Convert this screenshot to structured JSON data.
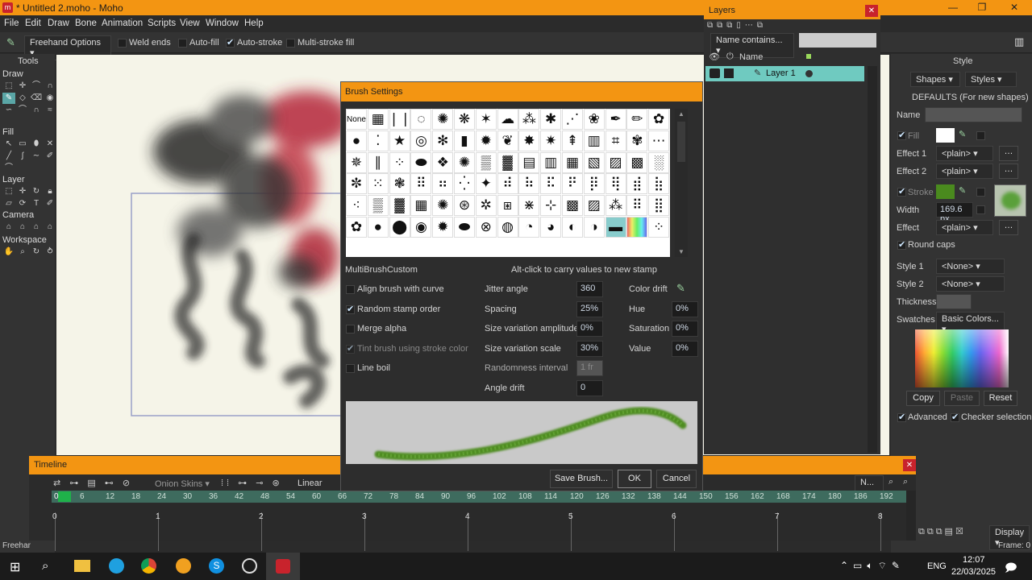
{
  "app": {
    "title": "* Untitled 2.moho - Moho",
    "logo": "moho-logo-icon"
  },
  "menu": [
    "File",
    "Edit",
    "Draw",
    "Bone",
    "Animation",
    "Scripts",
    "View",
    "Window",
    "Help"
  ],
  "options": {
    "freehand": "Freehand Options",
    "weld": "Weld ends",
    "autofill": "Auto-fill",
    "autostroke": "Auto-stroke",
    "multistroke": "Multi-stroke fill"
  },
  "tools": {
    "title": "Tools",
    "draw": "Draw",
    "fill": "Fill",
    "layer": "Layer",
    "camera": "Camera",
    "workspace": "Workspace",
    "status": "Freehar"
  },
  "layers": {
    "title": "Layers",
    "filter": "Name contains...",
    "col_name": "Name",
    "layer1": "Layer 1"
  },
  "brush": {
    "title": "Brush Settings",
    "none_label": "None",
    "name": "MultiBrushCustom",
    "hint": "Alt-click to carry values to new stamp",
    "checks": [
      {
        "label": "Align brush with curve",
        "on": false
      },
      {
        "label": "Random stamp order",
        "on": true
      },
      {
        "label": "Merge alpha",
        "on": false
      },
      {
        "label": "Tint brush using stroke color",
        "on": true
      },
      {
        "label": "Line boil",
        "on": false
      }
    ],
    "params": [
      {
        "label": "Jitter angle",
        "value": "360"
      },
      {
        "label": "Spacing",
        "value": "25%"
      },
      {
        "label": "Size variation amplitude",
        "value": "0%"
      },
      {
        "label": "Size variation scale",
        "value": "30%"
      },
      {
        "label": "Randomness interval",
        "value": "1 fr"
      },
      {
        "label": "Angle drift",
        "value": "0"
      }
    ],
    "color": [
      {
        "label": "Color drift",
        "value": ""
      },
      {
        "label": "Hue",
        "value": "0%"
      },
      {
        "label": "Saturation",
        "value": "0%"
      },
      {
        "label": "Value",
        "value": "0%"
      }
    ],
    "save": "Save Brush...",
    "ok": "OK",
    "cancel": "Cancel"
  },
  "style": {
    "title": "Style",
    "shapes": "Shapes",
    "styles": "Styles",
    "defaults": "DEFAULTS (For new shapes)",
    "name": "Name",
    "fill": "Fill",
    "effect1": "Effect 1",
    "effect2": "Effect 2",
    "plain": "<plain>",
    "stroke": "Stroke",
    "width": "Width",
    "width_val": "169.6 px",
    "effect": "Effect",
    "roundcaps": "Round caps",
    "style1": "Style 1",
    "style2": "Style 2",
    "none": "<None>",
    "thickness": "Thickness",
    "swatches": "Swatches",
    "swatch_val": "Basic Colors...",
    "copy": "Copy",
    "paste": "Paste",
    "reset": "Reset",
    "advanced": "Advanced",
    "checker": "Checker selection",
    "display": "Display",
    "frame": "Frame: 0",
    "stroke_color": "#4a8a1e"
  },
  "timeline": {
    "title": "Timeline",
    "onion": "Onion Skins",
    "interp": "Linear",
    "n": "N...",
    "ticks": [
      "0",
      "6",
      "12",
      "18",
      "24",
      "30",
      "36",
      "42",
      "48",
      "54",
      "60",
      "66",
      "72",
      "78",
      "84",
      "90",
      "96",
      "102",
      "108",
      "114",
      "120",
      "126",
      "132",
      "138",
      "144",
      "150",
      "156",
      "162",
      "168",
      "174",
      "180",
      "186",
      "192"
    ],
    "seconds": [
      "0",
      "1",
      "2",
      "3",
      "4",
      "5",
      "6",
      "7",
      "8"
    ]
  },
  "taskbar": {
    "lang": "ENG",
    "time": "12:07",
    "date": "22/03/2025"
  }
}
